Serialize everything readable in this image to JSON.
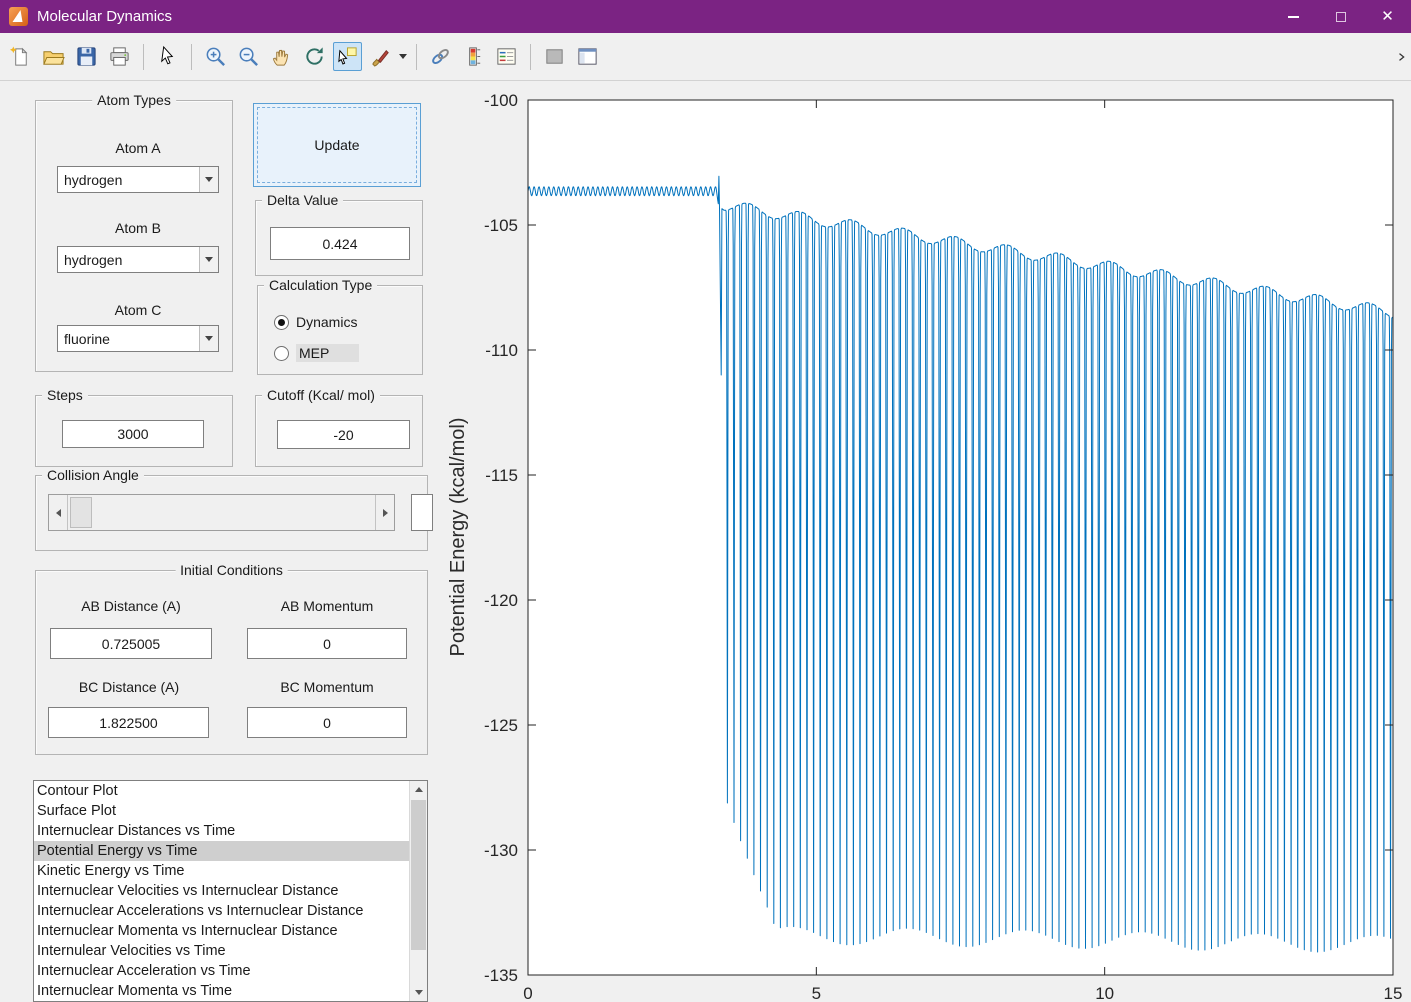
{
  "window": {
    "title": "Molecular Dynamics",
    "titlebar_color": "#7b2383",
    "buttons": [
      "minimize",
      "maximize",
      "close"
    ]
  },
  "toolbar": {
    "icons": [
      "new-figure",
      "open-file",
      "save-figure",
      "print-figure",
      "edit-plot",
      "zoom-in",
      "zoom-out",
      "pan",
      "rotate-3d",
      "data-cursor",
      "brush-data",
      "link-plot",
      "insert-colorbar",
      "insert-legend",
      "hide-plot-tools",
      "show-plot-tools"
    ],
    "active_tool": "data-cursor"
  },
  "panels": {
    "atom_types": {
      "title": "Atom Types",
      "atom_a_label": "Atom A",
      "atom_a_value": "hydrogen",
      "atom_b_label": "Atom B",
      "atom_b_value": "hydrogen",
      "atom_c_label": "Atom C",
      "atom_c_value": "fluorine"
    },
    "update_button": {
      "label": "Update"
    },
    "delta_value": {
      "title": "Delta Value",
      "value": "0.424"
    },
    "calculation_type": {
      "title": "Calculation Type",
      "options": [
        {
          "label": "Dynamics",
          "selected": true
        },
        {
          "label": "MEP",
          "selected": false
        }
      ]
    },
    "steps": {
      "title": "Steps",
      "value": "3000"
    },
    "cutoff": {
      "title": "Cutoff (Kcal/ mol)",
      "value": "-20"
    },
    "collision_angle": {
      "title": "Collision Angle",
      "edit_value": ""
    },
    "initial_conditions": {
      "title": "Initial Conditions",
      "ab_distance_label": "AB Distance (A)",
      "ab_distance_value": "0.725005",
      "ab_momentum_label": "AB Momentum",
      "ab_momentum_value": "0",
      "bc_distance_label": "BC Distance (A)",
      "bc_distance_value": "1.822500",
      "bc_momentum_label": "BC Momentum",
      "bc_momentum_value": "0"
    }
  },
  "plot_list": {
    "items": [
      "Contour Plot",
      "Surface Plot",
      "Internuclear Distances vs Time",
      "Potential Energy vs Time",
      "Kinetic Energy vs Time",
      "Internuclear Velocities vs Internuclear Distance",
      "Internuclear Accelerations vs Internuclear Distance",
      "Internuclear Momenta vs Internuclear Distance",
      "Internulear Velocities vs Time",
      "Internuclear Acceleration vs Time",
      "Internuclear Momenta vs Time"
    ],
    "selected_index": 3
  },
  "chart_data": {
    "type": "line",
    "title": "",
    "xlabel": "",
    "ylabel": "Potential Energy (kcal/mol)",
    "xlim": [
      0,
      15
    ],
    "ylim": [
      -135,
      -100
    ],
    "xticks": [
      0,
      5,
      10,
      15
    ],
    "yticks": [
      -135,
      -130,
      -125,
      -120,
      -115,
      -110,
      -105,
      -100
    ],
    "line_color": "#0072BD",
    "grid": false,
    "legend": "none",
    "series_description": "Potential energy of H-H-F collision trajectory: flat near -103.6 kcal/mol with small vibrational ripples until t~3.3, brief spike to -103 then deep dip to -127.4, followed by sustained large oscillations whose upper envelope decays from -104.2 to about -108.5 and lower envelope deepens to about -133.5 by t=15",
    "synthesis": {
      "flat_baseline": -103.65,
      "flat_ripple_amplitude": 0.18,
      "flat_ripple_period": 0.085,
      "flat_end": 3.27,
      "pre_spike_x": 3.31,
      "pre_spike_y": -103.05,
      "first_dip_x": 3.35,
      "first_dip_y": -111.0,
      "osc_start": 3.4,
      "osc_period": 0.115,
      "top_env_start": -104.2,
      "top_env_slope": 0.37,
      "bot_env_shallow": -127.4,
      "bot_env_deep": -133.4,
      "bot_env_ramp_end": 4.3,
      "bot_env_slope": 0.035,
      "spike_width": 0.075,
      "x_end": 15.0
    }
  }
}
